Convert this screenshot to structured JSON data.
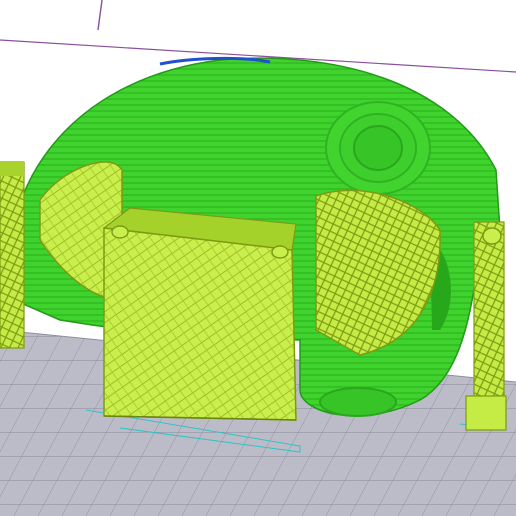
{
  "viewer": {
    "mode": "layer-preview",
    "background_color": "#ffffff",
    "bed_color": "#b9b9c6",
    "bed_grid_color": "#8d8d9e",
    "build_volume_line_color": "#8a4f9e"
  },
  "model": {
    "shell_color": "#3fd42d",
    "shell_dark_color": "#27a81b",
    "infill_color": "#c7ee4a",
    "infill_line_color": "#8fa81c",
    "top_edge_color": "#2050d0",
    "travel_color": "#2ec4c4"
  }
}
